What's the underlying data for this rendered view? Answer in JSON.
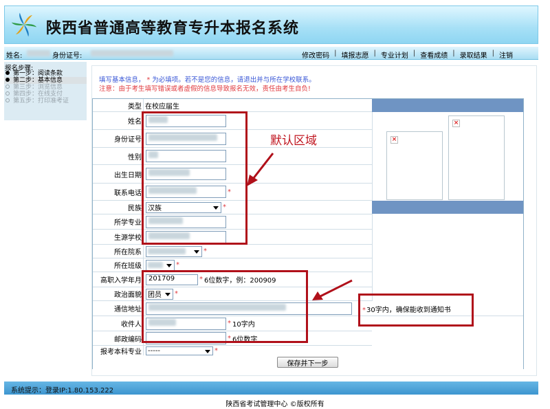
{
  "header": {
    "title": "陕西省普通高等教育专升本报名系统"
  },
  "userbar": {
    "name_label": "姓名:",
    "id_label": "身份证号:",
    "nav": [
      "修改密码",
      "填报志愿",
      "专业计划",
      "查看成绩",
      "录取结果",
      "注销"
    ]
  },
  "sidebar": {
    "title": "报名步骤:",
    "steps": [
      {
        "label": "第一步：阅读条款",
        "state": "done"
      },
      {
        "label": "第二步：基本信息",
        "state": "active"
      },
      {
        "label": "第三步：浏览信息",
        "state": "disabled"
      },
      {
        "label": "第四步：在线支付",
        "state": "disabled"
      },
      {
        "label": "第五步：打印准考证",
        "state": "disabled"
      }
    ]
  },
  "notice": {
    "line1_a": "填写基本信息，",
    "star": "*",
    "line1_b": "为必填项。若不是您的信息，请退出并与所在学校联系。",
    "line2": "注意：由于考生填写错误或者虚假的信息导致报名无效，责任由考生自负!"
  },
  "form": {
    "type_label": "类型",
    "type_value": "在校应届生",
    "name_label": "姓名",
    "id_label": "身份证号",
    "gender_label": "性别",
    "birth_label": "出生日期",
    "phone_label": "联系电话",
    "ethnic_label": "民族",
    "ethnic_value": "汉族",
    "major_label": "所学专业",
    "school_label": "生源学校",
    "dept_label": "所在院系",
    "class_label": "所在班级",
    "enroll_label": "高职入学年月",
    "enroll_value": "201709",
    "enroll_hint": "6位数字，例：200909",
    "political_label": "政治面貌",
    "political_value": "团员",
    "address_label": "通信地址",
    "address_hint": "30字内，确保能收到通知书",
    "recipient_label": "收件人",
    "recipient_hint": "10字内",
    "postcode_label": "邮政编码",
    "postcode_hint": "6位数字",
    "apply_major_label": "报考本科专业",
    "apply_major_value": "-----",
    "submit_label": "保存并下一步",
    "required_mark": "*"
  },
  "annotation": {
    "text": "默认区域"
  },
  "status": {
    "text": "系统提示：登录IP:1.80.153.222"
  },
  "footer": {
    "text": "陕西省考试管理中心 ©版权所有"
  },
  "colors": {
    "header_bg": "#a6e0f6",
    "statusbar_bg": "#3d95cf",
    "photo_header": "#6f94c3",
    "annotation": "#b0101a",
    "required": "#e0393e"
  }
}
